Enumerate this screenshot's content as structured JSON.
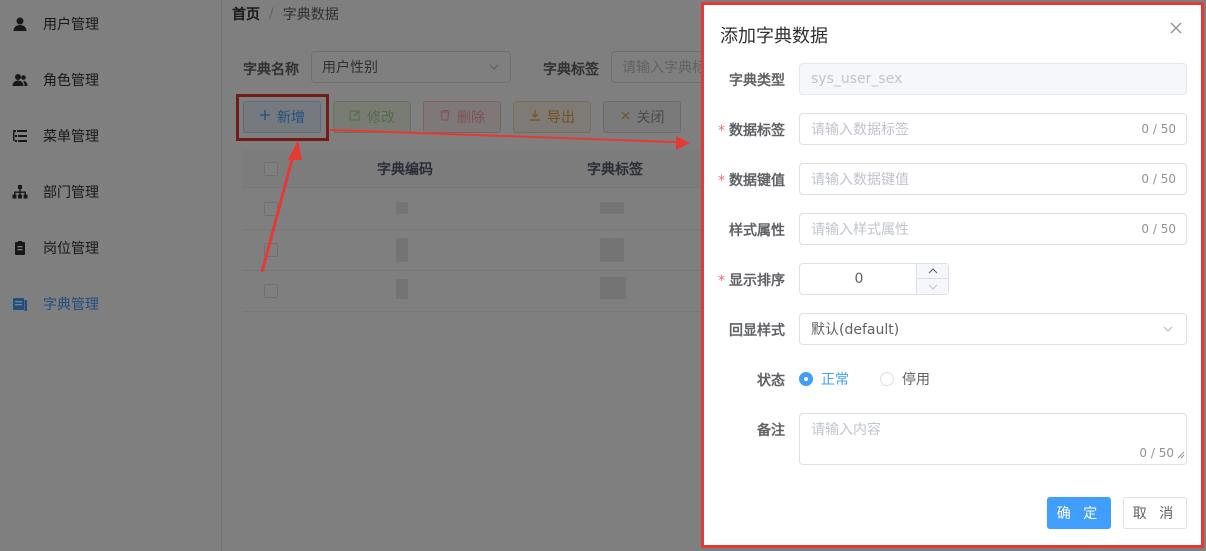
{
  "sidebar": {
    "items": [
      {
        "label": "用户管理",
        "icon": "user-icon"
      },
      {
        "label": "角色管理",
        "icon": "users-icon"
      },
      {
        "label": "菜单管理",
        "icon": "tree-table-icon"
      },
      {
        "label": "部门管理",
        "icon": "org-tree-icon"
      },
      {
        "label": "岗位管理",
        "icon": "post-icon"
      },
      {
        "label": "字典管理",
        "icon": "dict-icon",
        "active": true
      }
    ]
  },
  "breadcrumb": {
    "home": "首页",
    "separator": "/",
    "current": "字典数据"
  },
  "search": {
    "dict_name_label": "字典名称",
    "dict_name_value": "用户性别",
    "dict_label_label": "字典标签",
    "dict_label_placeholder": "请输入字典标签"
  },
  "toolbar": {
    "add": "新增",
    "edit": "修改",
    "delete": "删除",
    "export": "导出",
    "close": "关闭"
  },
  "table": {
    "columns": [
      "字典编码",
      "字典标签"
    ]
  },
  "dialog": {
    "title": "添加字典数据",
    "dict_type_label": "字典类型",
    "dict_type_value": "sys_user_sex",
    "data_label_label": "数据标签",
    "data_label_placeholder": "请输入数据标签",
    "data_label_count": "0 / 50",
    "data_value_label": "数据键值",
    "data_value_placeholder": "请输入数据键值",
    "data_value_count": "0 / 50",
    "css_class_label": "样式属性",
    "css_class_placeholder": "请输入样式属性",
    "css_class_count": "0 / 50",
    "sort_label": "显示排序",
    "sort_value": "0",
    "list_class_label": "回显样式",
    "list_class_value": "默认(default)",
    "status_label": "状态",
    "status_options": [
      "正常",
      "停用"
    ],
    "status_selected": "正常",
    "remark_label": "备注",
    "remark_placeholder": "请输入内容",
    "remark_count": "0 / 50",
    "required_mark": "*",
    "confirm": "确 定",
    "cancel": "取 消"
  },
  "colors": {
    "primary": "#409eff",
    "highlight": "#e53935",
    "required": "#f56c6c"
  }
}
